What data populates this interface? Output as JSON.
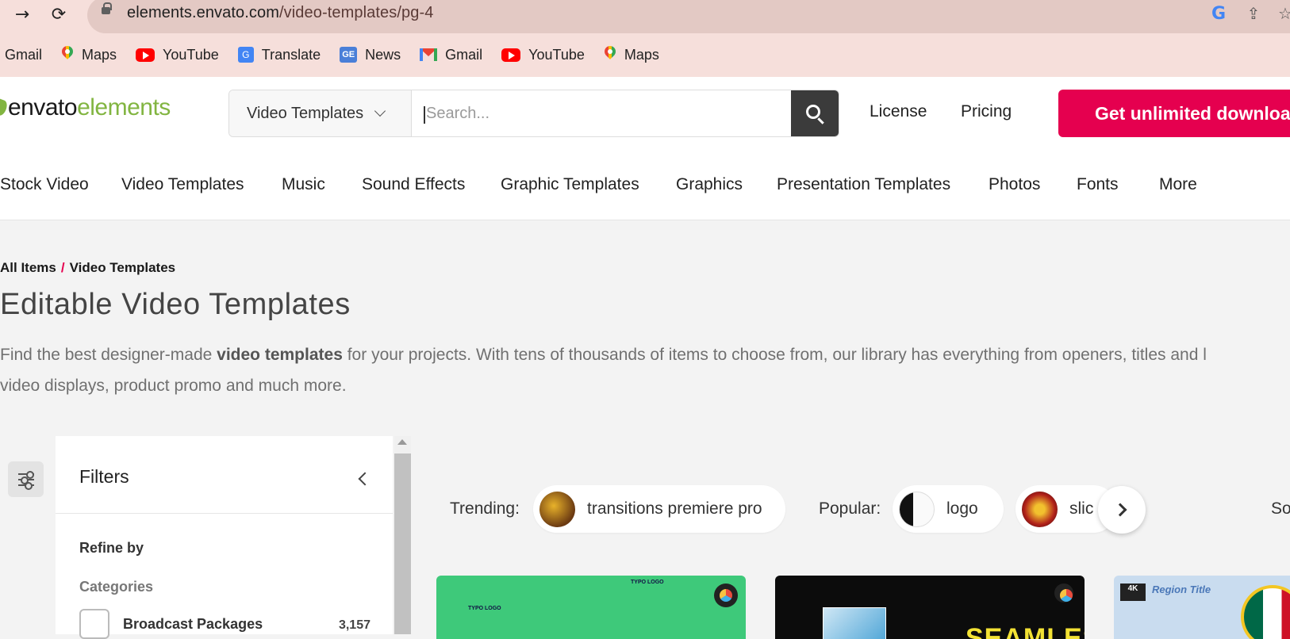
{
  "browser": {
    "url_host": "elements.envato.com",
    "url_path": "/video-templates/pg-4",
    "bookmarks": [
      {
        "label": "Gmail",
        "icon": "none"
      },
      {
        "label": "Maps",
        "icon": "maps-icon"
      },
      {
        "label": "YouTube",
        "icon": "youtube-icon"
      },
      {
        "label": "Translate",
        "icon": "translate-icon"
      },
      {
        "label": "News",
        "icon": "news-icon"
      },
      {
        "label": "Gmail",
        "icon": "gmail-icon"
      },
      {
        "label": "YouTube",
        "icon": "youtube-icon"
      },
      {
        "label": "Maps",
        "icon": "maps-icon"
      }
    ]
  },
  "header": {
    "logo_part1": "envato",
    "logo_part2": "elements",
    "category_select": "Video Templates",
    "search_placeholder": "Search...",
    "license": "License",
    "pricing": "Pricing",
    "cta": "Get unlimited downloads"
  },
  "catnav": [
    "Stock Video",
    "Video Templates",
    "Music",
    "Sound Effects",
    "Graphic Templates",
    "Graphics",
    "Presentation Templates",
    "Photos",
    "Fonts",
    "More"
  ],
  "breadcrumb": {
    "root": "All Items",
    "sep": "/",
    "current": "Video Templates"
  },
  "page": {
    "title": "Editable Video Templates",
    "intro_pre": "Find the best designer-made ",
    "intro_bold": "video templates",
    "intro_post": " for your projects. With tens of thousands of items to choose from, our library has everything from openers, titles and l",
    "intro_line2": "video displays, product promo and much more."
  },
  "filters": {
    "title": "Filters",
    "refine_by": "Refine by",
    "categories_label": "Categories",
    "first_category": {
      "name": "Broadcast Packages",
      "count": "3,157"
    }
  },
  "trending": {
    "label": "Trending:",
    "item": "transitions premiere pro",
    "popular_label": "Popular:",
    "popular_items": [
      "logo",
      "slic"
    ],
    "sort_label": "So"
  },
  "cards": {
    "card1_text_a": "TYPO LOGO",
    "card1_text_b": "TYPO LOGO",
    "card2_text": "SEAMLESS",
    "card3_badge": "4K",
    "card3_text": "Region Title"
  },
  "colors": {
    "brand_green": "#82b541",
    "cta_red": "#e5004f",
    "chrome_bg": "#f6dfdb"
  }
}
